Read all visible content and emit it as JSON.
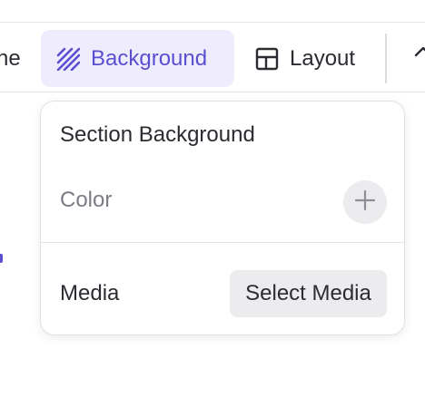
{
  "toolbar": {
    "partial_label": "ne",
    "background_label": "Background",
    "layout_label": "Layout",
    "active_color": "#5b4fd1",
    "active_bg": "#efedfd"
  },
  "popover": {
    "title": "Section Background",
    "color_label": "Color",
    "media_label": "Media",
    "select_media_label": "Select Media"
  },
  "icons": {
    "background": "diagonal-stripes-icon",
    "layout": "layout-grid-icon",
    "add": "plus-icon",
    "partial_right": "chevron-up-icon"
  }
}
